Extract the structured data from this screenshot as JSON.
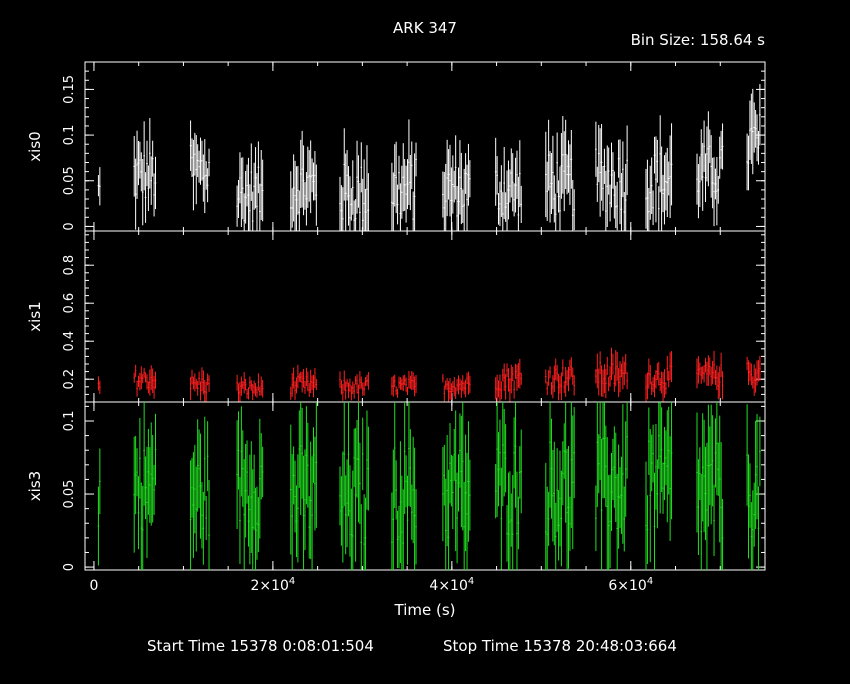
{
  "chart_data": {
    "type": "scatter",
    "title": "ARK 347",
    "bin_size_label": "Bin Size: 158.64 s",
    "xlabel": "Time (s)",
    "xlim": [
      -1000,
      75000
    ],
    "x_ticks": [
      {
        "value": 0,
        "label": "0"
      },
      {
        "value": 20000,
        "label": "2×10^4"
      },
      {
        "value": 40000,
        "label": "4×10^4"
      },
      {
        "value": 60000,
        "label": "6×10^4"
      }
    ],
    "footer": {
      "start": "Start Time 15378  0:08:01:504",
      "stop": "Stop Time 15378 20:48:03:664"
    },
    "panels": [
      {
        "name": "xis0",
        "ylabel": "xis0",
        "color": "#ffffff",
        "ylim": [
          -0.005,
          0.18
        ],
        "y_ticks": [
          {
            "value": 0,
            "label": "0"
          },
          {
            "value": 0.05,
            "label": "0.05"
          },
          {
            "value": 0.1,
            "label": "0.1"
          },
          {
            "value": 0.15,
            "label": "0.15"
          }
        ],
        "segments": [
          {
            "t0": 500,
            "t1": 800,
            "mean": 0.04,
            "spread": 0.03
          },
          {
            "t0": 4500,
            "t1": 7000,
            "mean": 0.055,
            "spread": 0.06
          },
          {
            "t0": 10800,
            "t1": 13000,
            "mean": 0.06,
            "spread": 0.06
          },
          {
            "t0": 16000,
            "t1": 19000,
            "mean": 0.035,
            "spread": 0.06
          },
          {
            "t0": 22000,
            "t1": 24900,
            "mean": 0.045,
            "spread": 0.06
          },
          {
            "t0": 27500,
            "t1": 30700,
            "mean": 0.035,
            "spread": 0.07
          },
          {
            "t0": 33300,
            "t1": 36100,
            "mean": 0.04,
            "spread": 0.07
          },
          {
            "t0": 39000,
            "t1": 42100,
            "mean": 0.04,
            "spread": 0.06
          },
          {
            "t0": 44900,
            "t1": 47900,
            "mean": 0.04,
            "spread": 0.06
          },
          {
            "t0": 50500,
            "t1": 53800,
            "mean": 0.045,
            "spread": 0.07
          },
          {
            "t0": 56100,
            "t1": 59700,
            "mean": 0.05,
            "spread": 0.07
          },
          {
            "t0": 61700,
            "t1": 64700,
            "mean": 0.05,
            "spread": 0.07
          },
          {
            "t0": 67400,
            "t1": 70400,
            "mean": 0.06,
            "spread": 0.06
          },
          {
            "t0": 73000,
            "t1": 74500,
            "mean": 0.09,
            "spread": 0.07
          }
        ]
      },
      {
        "name": "xis1",
        "ylabel": "xis1",
        "color": "#ff2020",
        "ylim": [
          0.08,
          0.98
        ],
        "y_ticks": [
          {
            "value": 0.2,
            "label": "0.2"
          },
          {
            "value": 0.4,
            "label": "0.4"
          },
          {
            "value": 0.6,
            "label": "0.6"
          },
          {
            "value": 0.8,
            "label": "0.8"
          }
        ],
        "segments": [
          {
            "t0": 500,
            "t1": 800,
            "mean": 0.16,
            "spread": 0.06
          },
          {
            "t0": 4500,
            "t1": 7000,
            "mean": 0.2,
            "spread": 0.1
          },
          {
            "t0": 10800,
            "t1": 13000,
            "mean": 0.17,
            "spread": 0.1
          },
          {
            "t0": 16000,
            "t1": 19000,
            "mean": 0.15,
            "spread": 0.08
          },
          {
            "t0": 22000,
            "t1": 24900,
            "mean": 0.17,
            "spread": 0.09
          },
          {
            "t0": 27500,
            "t1": 30700,
            "mean": 0.16,
            "spread": 0.08
          },
          {
            "t0": 33300,
            "t1": 36100,
            "mean": 0.16,
            "spread": 0.08
          },
          {
            "t0": 39000,
            "t1": 42100,
            "mean": 0.17,
            "spread": 0.09
          },
          {
            "t0": 44900,
            "t1": 47900,
            "mean": 0.2,
            "spread": 0.12
          },
          {
            "t0": 50500,
            "t1": 53800,
            "mean": 0.21,
            "spread": 0.12
          },
          {
            "t0": 56100,
            "t1": 59700,
            "mean": 0.22,
            "spread": 0.14
          },
          {
            "t0": 61700,
            "t1": 64700,
            "mean": 0.21,
            "spread": 0.12
          },
          {
            "t0": 67400,
            "t1": 70400,
            "mean": 0.22,
            "spread": 0.12
          },
          {
            "t0": 73000,
            "t1": 74500,
            "mean": 0.23,
            "spread": 0.12
          }
        ]
      },
      {
        "name": "xis3",
        "ylabel": "xis3",
        "color": "#20e020",
        "ylim": [
          -0.002,
          0.113
        ],
        "y_ticks": [
          {
            "value": 0,
            "label": "0"
          },
          {
            "value": 0.05,
            "label": "0.05"
          },
          {
            "value": 0.1,
            "label": "0.1"
          }
        ],
        "segments": [
          {
            "t0": 500,
            "t1": 800,
            "mean": 0.05,
            "spread": 0.05
          },
          {
            "t0": 4500,
            "t1": 7000,
            "mean": 0.055,
            "spread": 0.06
          },
          {
            "t0": 10800,
            "t1": 13000,
            "mean": 0.05,
            "spread": 0.06
          },
          {
            "t0": 16000,
            "t1": 19000,
            "mean": 0.055,
            "spread": 0.06
          },
          {
            "t0": 22000,
            "t1": 24900,
            "mean": 0.05,
            "spread": 0.07
          },
          {
            "t0": 27500,
            "t1": 30700,
            "mean": 0.045,
            "spread": 0.07
          },
          {
            "t0": 33300,
            "t1": 36100,
            "mean": 0.05,
            "spread": 0.07
          },
          {
            "t0": 39000,
            "t1": 42100,
            "mean": 0.05,
            "spread": 0.07
          },
          {
            "t0": 44900,
            "t1": 47900,
            "mean": 0.055,
            "spread": 0.07
          },
          {
            "t0": 50500,
            "t1": 53800,
            "mean": 0.055,
            "spread": 0.07
          },
          {
            "t0": 56100,
            "t1": 59700,
            "mean": 0.055,
            "spread": 0.07
          },
          {
            "t0": 61700,
            "t1": 64700,
            "mean": 0.055,
            "spread": 0.07
          },
          {
            "t0": 67400,
            "t1": 70400,
            "mean": 0.05,
            "spread": 0.07
          },
          {
            "t0": 73000,
            "t1": 74500,
            "mean": 0.05,
            "spread": 0.06
          }
        ]
      }
    ]
  }
}
